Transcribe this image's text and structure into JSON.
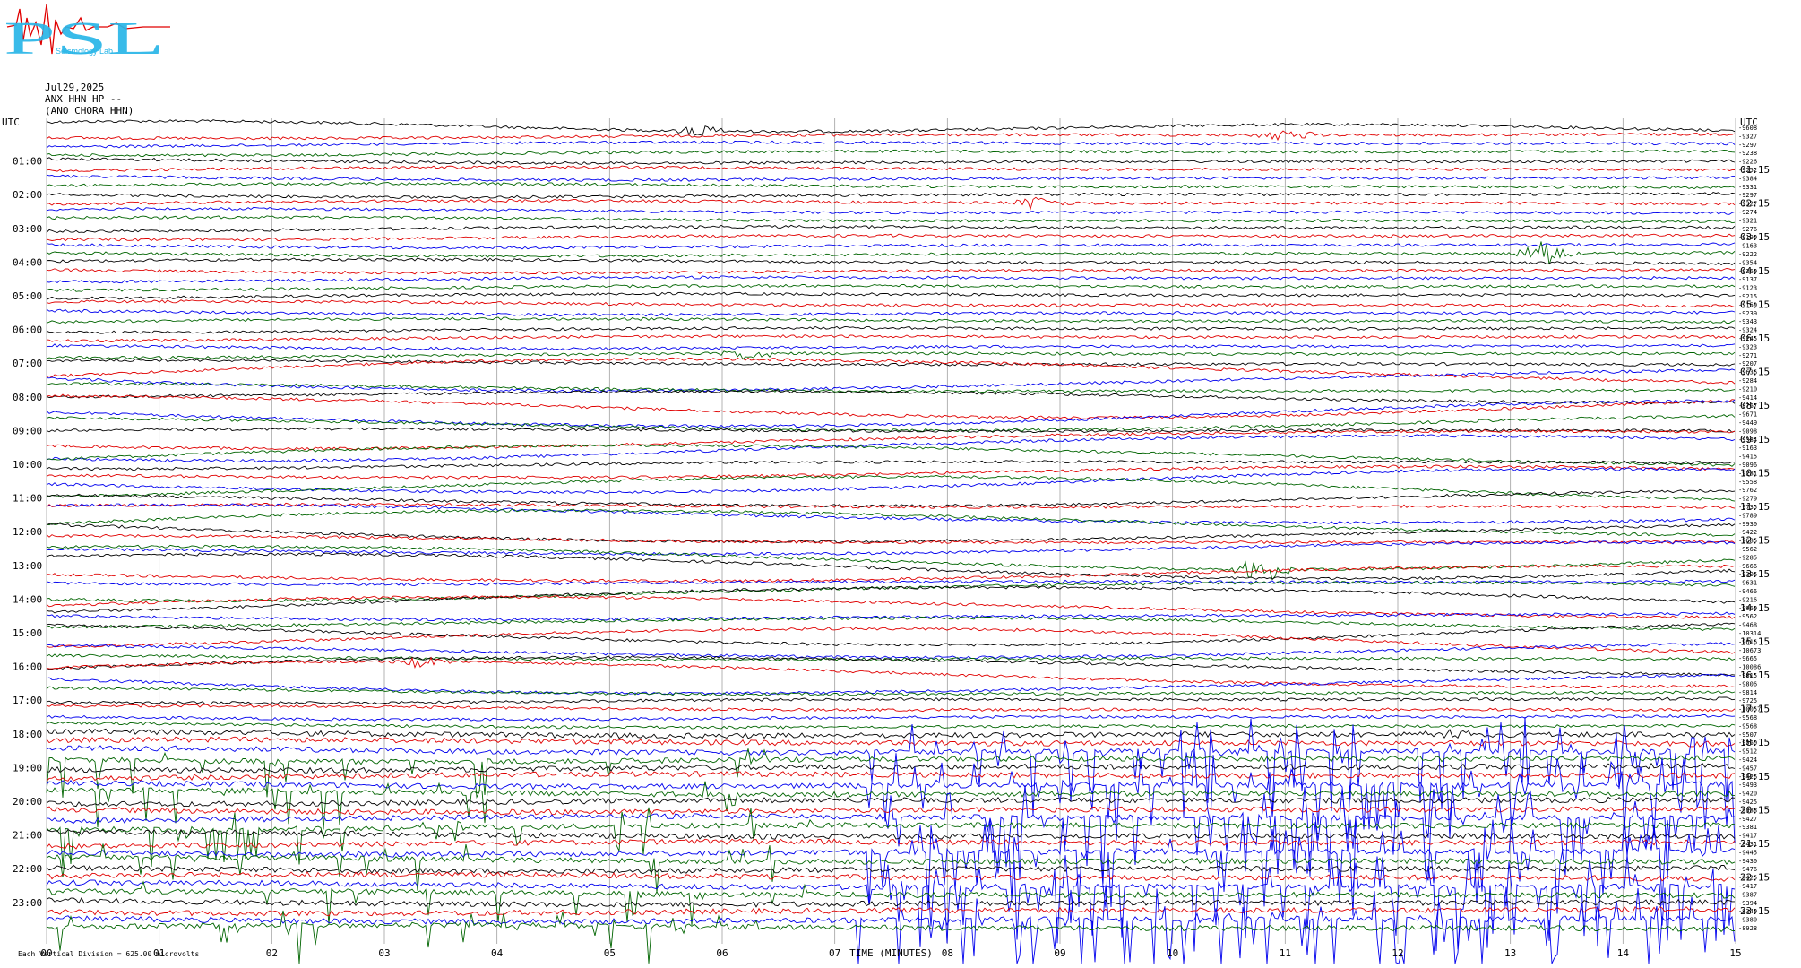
{
  "header": {
    "logo_text": "PSL",
    "logo_subtext": "Seismology Lab",
    "date": "Jul29,2025",
    "station": "ANX HHN HP --",
    "network": "(ANO CHORA HHN)"
  },
  "colors": {
    "black": "#000000",
    "red": "#e00000",
    "blue": "#0000ee",
    "green": "#006400",
    "grid": "#a0a0a0",
    "logo": "#29b6e8"
  },
  "chart_data": {
    "type": "line",
    "left_axis_label": "UTC",
    "right_axis_label": "UTC",
    "hour_labels_left": [
      "01:00",
      "02:00",
      "03:00",
      "04:00",
      "05:00",
      "06:00",
      "07:00",
      "08:00",
      "09:00",
      "10:00",
      "11:00",
      "12:00",
      "13:00",
      "14:00",
      "15:00",
      "16:00",
      "17:00",
      "18:00",
      "19:00",
      "20:00",
      "21:00",
      "22:00",
      "23:00"
    ],
    "hour_labels_right": [
      "01:15",
      "02:15",
      "03:15",
      "04:15",
      "05:15",
      "06:15",
      "07:15",
      "08:15",
      "09:15",
      "10:15",
      "11:15",
      "12:15",
      "13:15",
      "14:15",
      "15:15",
      "16:15",
      "17:15",
      "18:15",
      "19:15",
      "20:15",
      "21:15",
      "22:15",
      "23:15"
    ],
    "x_ticks": [
      "00",
      "01",
      "02",
      "03",
      "04",
      "05",
      "06",
      "07",
      "08",
      "09",
      "10",
      "11",
      "12",
      "13",
      "14",
      "15"
    ],
    "x_range": [
      0,
      15
    ],
    "xlabel": "TIME (MINUTES)",
    "footer_left": "Each Vertical Division = 625.00 microvolts",
    "trace_colors_cycle": [
      "black",
      "red",
      "blue",
      "green"
    ],
    "trace_count": 96,
    "trace_minutes_per_line": 15,
    "right_offsets": [
      "-9608",
      "-9327",
      "-9297",
      "-9238",
      "-9226",
      "-9252",
      "-9384",
      "-9331",
      "-9297",
      "-9327",
      "-9274",
      "-9321",
      "-9276",
      "-9190",
      "-9163",
      "-9222",
      "-9354",
      "-9269",
      "-9137",
      "-9123",
      "-9215",
      "-9159",
      "-9239",
      "-9343",
      "-9324",
      "-9245",
      "-9323",
      "-9271",
      "-9207",
      "-9636",
      "-9284",
      "-9210",
      "-9414",
      "-8767",
      "-9671",
      "-9449",
      "-9098",
      "-9384",
      "-9163",
      "-9415",
      "-9096",
      "-9281",
      "-9558",
      "-9762",
      "-9279",
      "-9735",
      "-9789",
      "-9930",
      "-9422",
      "-9685",
      "-9562",
      "-9285",
      "-9666",
      "-9306",
      "-9631",
      "-9466",
      "-9216",
      "-9969",
      "-9562",
      "-9468",
      "-10314",
      "-9616",
      "-10673",
      "-9665",
      "-10086",
      "-9815",
      "-9806",
      "-9814",
      "-9725",
      "-10057",
      "-9568",
      "-9568",
      "-9507",
      "-9560",
      "-9512",
      "-9424",
      "-9457",
      "-9426",
      "-9493",
      "-9420",
      "-9425",
      "-9388",
      "-9427",
      "-9381",
      "-9417",
      "-9431",
      "-9445",
      "-9430",
      "-9476",
      "-9425",
      "-9417",
      "-9387",
      "-9394",
      "-9349",
      "-9380",
      "-8928"
    ],
    "events": [
      {
        "time": "00:00",
        "minute": 5.8,
        "amplitude": "medium"
      },
      {
        "time": "00:15",
        "minute": 11.0,
        "amplitude": "medium"
      },
      {
        "time": "02:15",
        "minute": 8.8,
        "amplitude": "medium"
      },
      {
        "time": "03:45",
        "minute": 13.3,
        "amplitude": "high"
      },
      {
        "time": "06:45",
        "minute": 6.2,
        "amplitude": "medium"
      },
      {
        "time": "12:45",
        "minute": 10.8,
        "amplitude": "high"
      },
      {
        "time": "16:15",
        "minute": 3.3,
        "amplitude": "medium"
      },
      {
        "time": "18:00",
        "minute": 12.5,
        "amplitude": "medium"
      }
    ]
  }
}
